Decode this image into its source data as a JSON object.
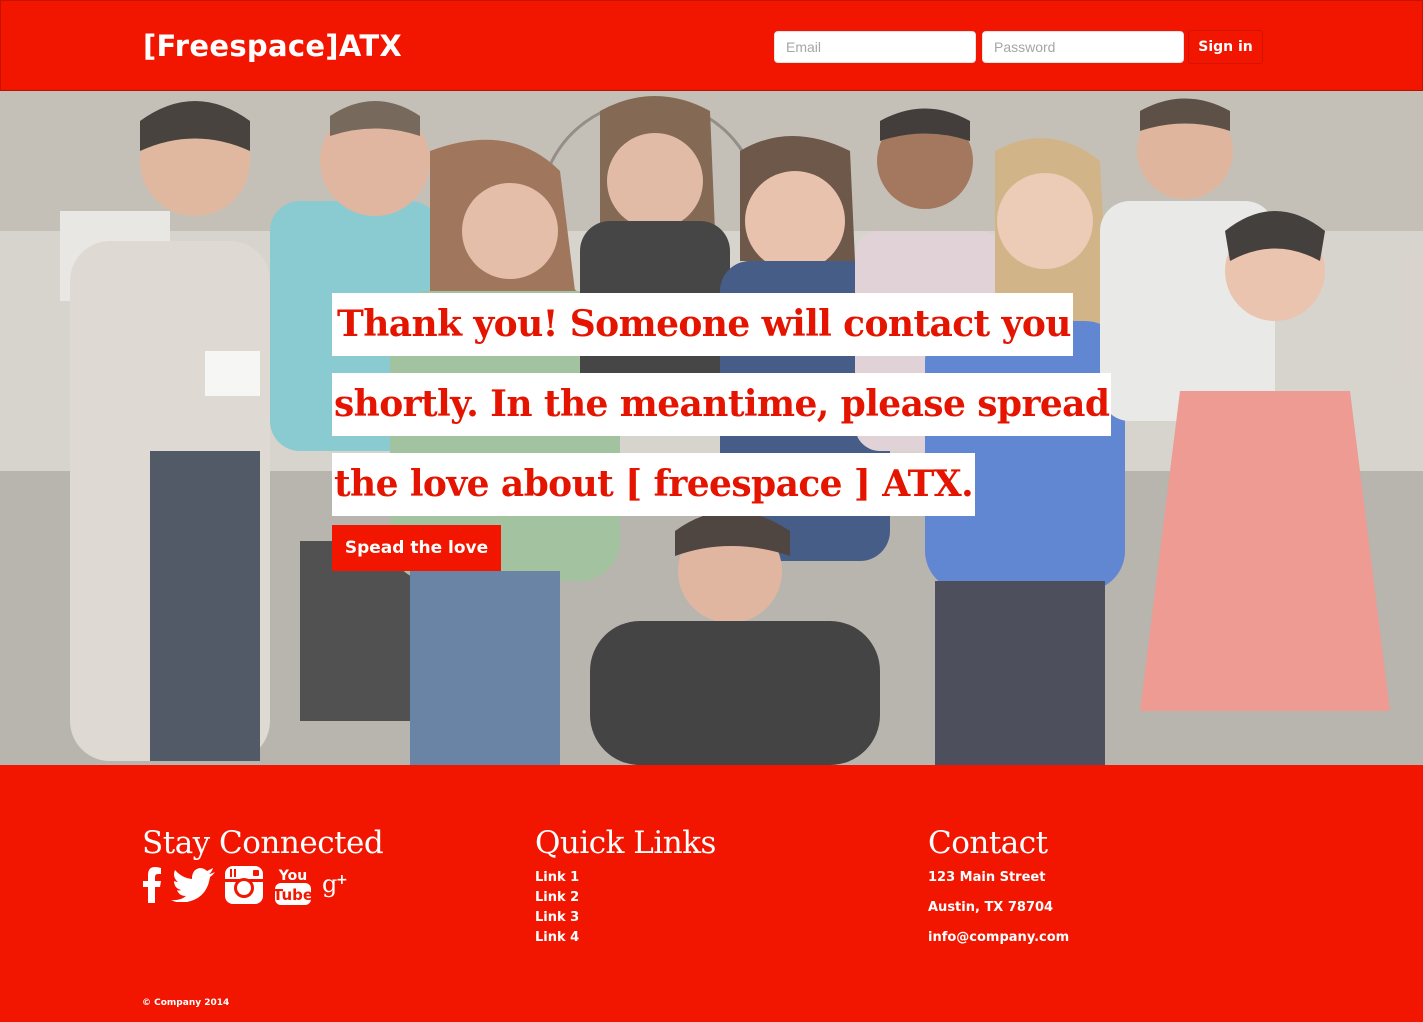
{
  "header": {
    "brand": "[Freespace]ATX",
    "email_placeholder": "Email",
    "password_placeholder": "Password",
    "signin_label": "Sign in"
  },
  "hero": {
    "message_lines": [
      "Thank you! Someone will contact you",
      "shortly. In the meantime, please spread",
      "the love about [ freespace ] ATX."
    ],
    "button_label": "Spead the love"
  },
  "footer": {
    "stay_connected": {
      "heading": "Stay Connected",
      "icons": [
        "facebook-icon",
        "twitter-icon",
        "instagram-icon",
        "youtube-icon",
        "google-plus-icon"
      ]
    },
    "quick_links": {
      "heading": "Quick Links",
      "links": [
        "Link 1",
        "Link 2",
        "Link 3",
        "Link 4"
      ]
    },
    "contact": {
      "heading": "Contact",
      "street": "123 Main Street",
      "city": "Austin, TX 78704",
      "email": "info@company.com"
    },
    "copyright": "© Company 2014"
  },
  "colors": {
    "brand_red": "#f21600",
    "text_red": "#e41400",
    "white": "#ffffff"
  }
}
